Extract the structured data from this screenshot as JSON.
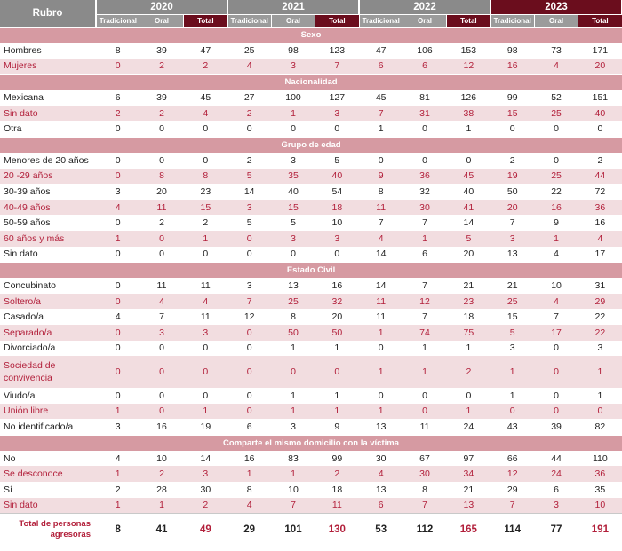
{
  "header": {
    "rubro_label": "Rubro",
    "years": [
      "2020",
      "2021",
      "2022",
      "2023"
    ],
    "subcols": [
      "Tradicional",
      "Oral",
      "Total"
    ]
  },
  "sections": [
    {
      "title": "Sexo",
      "rows": [
        {
          "label": "Hombres",
          "values": [
            "8",
            "39",
            "47",
            "25",
            "98",
            "123",
            "47",
            "106",
            "153",
            "98",
            "73",
            "171"
          ]
        },
        {
          "label": "Mujeres",
          "values": [
            "0",
            "2",
            "2",
            "4",
            "3",
            "7",
            "6",
            "6",
            "12",
            "16",
            "4",
            "20"
          ]
        }
      ]
    },
    {
      "title": "Nacionalidad",
      "rows": [
        {
          "label": "Mexicana",
          "values": [
            "6",
            "39",
            "45",
            "27",
            "100",
            "127",
            "45",
            "81",
            "126",
            "99",
            "52",
            "151"
          ]
        },
        {
          "label": "Sin dato",
          "values": [
            "2",
            "2",
            "4",
            "2",
            "1",
            "3",
            "7",
            "31",
            "38",
            "15",
            "25",
            "40"
          ]
        },
        {
          "label": "Otra",
          "values": [
            "0",
            "0",
            "0",
            "0",
            "0",
            "0",
            "1",
            "0",
            "1",
            "0",
            "0",
            "0"
          ]
        }
      ]
    },
    {
      "title": "Grupo de edad",
      "rows": [
        {
          "label": "Menores de 20 años",
          "values": [
            "0",
            "0",
            "0",
            "2",
            "3",
            "5",
            "0",
            "0",
            "0",
            "2",
            "0",
            "2"
          ]
        },
        {
          "label": "20 -29 años",
          "values": [
            "0",
            "8",
            "8",
            "5",
            "35",
            "40",
            "9",
            "36",
            "45",
            "19",
            "25",
            "44"
          ]
        },
        {
          "label": "30-39 años",
          "values": [
            "3",
            "20",
            "23",
            "14",
            "40",
            "54",
            "8",
            "32",
            "40",
            "50",
            "22",
            "72"
          ]
        },
        {
          "label": "40-49 años",
          "values": [
            "4",
            "11",
            "15",
            "3",
            "15",
            "18",
            "11",
            "30",
            "41",
            "20",
            "16",
            "36"
          ]
        },
        {
          "label": "50-59 años",
          "values": [
            "0",
            "2",
            "2",
            "5",
            "5",
            "10",
            "7",
            "7",
            "14",
            "7",
            "9",
            "16"
          ]
        },
        {
          "label": "60 años y más",
          "values": [
            "1",
            "0",
            "1",
            "0",
            "3",
            "3",
            "4",
            "1",
            "5",
            "3",
            "1",
            "4"
          ]
        },
        {
          "label": "Sin dato",
          "values": [
            "0",
            "0",
            "0",
            "0",
            "0",
            "0",
            "14",
            "6",
            "20",
            "13",
            "4",
            "17"
          ]
        }
      ]
    },
    {
      "title": "Estado Civil",
      "rows": [
        {
          "label": "Concubinato",
          "values": [
            "0",
            "11",
            "11",
            "3",
            "13",
            "16",
            "14",
            "7",
            "21",
            "21",
            "10",
            "31"
          ]
        },
        {
          "label": "Soltero/a",
          "values": [
            "0",
            "4",
            "4",
            "7",
            "25",
            "32",
            "11",
            "12",
            "23",
            "25",
            "4",
            "29"
          ]
        },
        {
          "label": "Casado/a",
          "values": [
            "4",
            "7",
            "11",
            "12",
            "8",
            "20",
            "11",
            "7",
            "18",
            "15",
            "7",
            "22"
          ]
        },
        {
          "label": "Separado/a",
          "values": [
            "0",
            "3",
            "3",
            "0",
            "50",
            "50",
            "1",
            "74",
            "75",
            "5",
            "17",
            "22"
          ]
        },
        {
          "label": "Divorciado/a",
          "values": [
            "0",
            "0",
            "0",
            "0",
            "1",
            "1",
            "0",
            "1",
            "1",
            "3",
            "0",
            "3"
          ]
        },
        {
          "label": "Sociedad de convivencia",
          "values": [
            "0",
            "0",
            "0",
            "0",
            "0",
            "0",
            "1",
            "1",
            "2",
            "1",
            "0",
            "1"
          ]
        },
        {
          "label": "Viudo/a",
          "values": [
            "0",
            "0",
            "0",
            "0",
            "1",
            "1",
            "0",
            "0",
            "0",
            "1",
            "0",
            "1"
          ]
        },
        {
          "label": "Unión libre",
          "values": [
            "1",
            "0",
            "1",
            "0",
            "1",
            "1",
            "1",
            "0",
            "1",
            "0",
            "0",
            "0"
          ]
        },
        {
          "label": "No identificado/a",
          "values": [
            "3",
            "16",
            "19",
            "6",
            "3",
            "9",
            "13",
            "11",
            "24",
            "43",
            "39",
            "82"
          ]
        }
      ]
    },
    {
      "title": "Comparte el mismo domicilio con la víctima",
      "rows": [
        {
          "label": "No",
          "values": [
            "4",
            "10",
            "14",
            "16",
            "83",
            "99",
            "30",
            "67",
            "97",
            "66",
            "44",
            "110"
          ]
        },
        {
          "label": "Se desconoce",
          "values": [
            "1",
            "2",
            "3",
            "1",
            "1",
            "2",
            "4",
            "30",
            "34",
            "12",
            "24",
            "36"
          ]
        },
        {
          "label": "Sí",
          "values": [
            "2",
            "28",
            "30",
            "8",
            "10",
            "18",
            "13",
            "8",
            "21",
            "29",
            "6",
            "35"
          ]
        },
        {
          "label": "Sin dato",
          "values": [
            "1",
            "1",
            "2",
            "4",
            "7",
            "11",
            "6",
            "7",
            "13",
            "7",
            "3",
            "10"
          ]
        }
      ]
    }
  ],
  "footer": {
    "label": "Total de personas agresoras",
    "values": [
      "8",
      "41",
      "49",
      "29",
      "101",
      "130",
      "53",
      "112",
      "165",
      "114",
      "77",
      "191"
    ]
  },
  "colors": {
    "header_gray": "#8a8a8a",
    "header_dark": "#6b0d1d",
    "section_band": "#d69aa2",
    "pink_row": "#f2dde0",
    "accent_text": "#b21f3a"
  }
}
